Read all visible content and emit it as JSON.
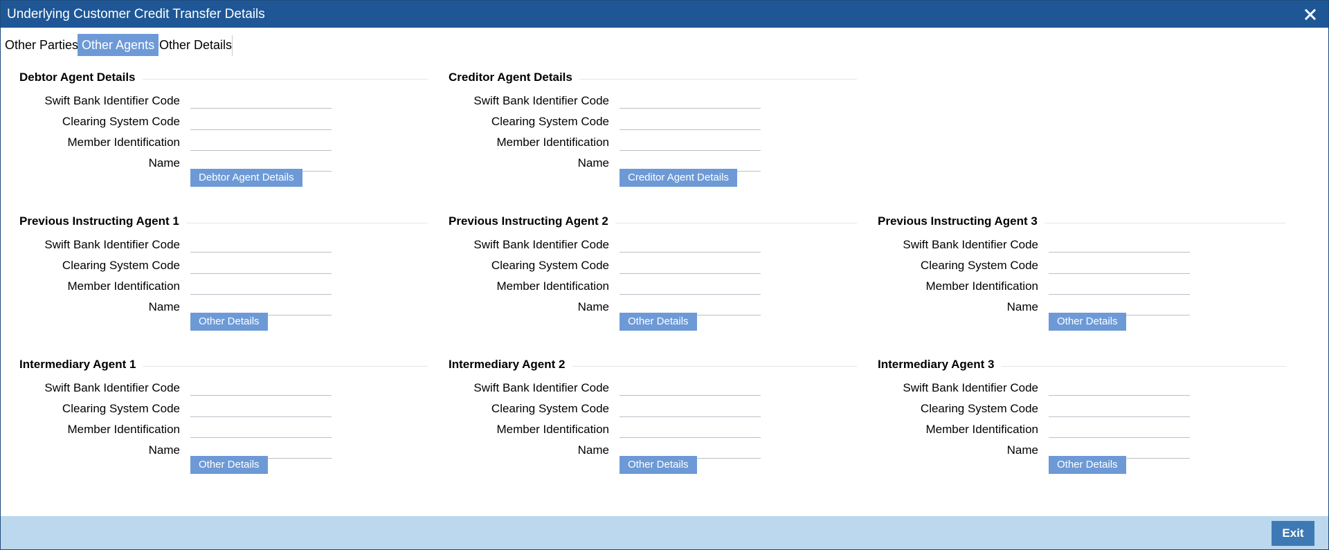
{
  "window": {
    "title": "Underlying Customer Credit Transfer Details",
    "close_icon": "close-icon"
  },
  "tabs": [
    {
      "label": "Other Parties",
      "active": false
    },
    {
      "label": "Other Agents",
      "active": true
    },
    {
      "label": "Other Details",
      "active": false
    }
  ],
  "sections": [
    {
      "heading": "Debtor Agent Details",
      "labels": [
        "Swift Bank Identifier Code",
        "Clearing System Code",
        "Member Identification",
        "Name"
      ],
      "values": [
        "",
        "",
        "",
        ""
      ],
      "button": "Debtor Agent Details"
    },
    {
      "heading": "Creditor Agent Details",
      "labels": [
        "Swift Bank Identifier Code",
        "Clearing System Code",
        "Member Identification",
        "Name"
      ],
      "values": [
        "",
        "",
        "",
        ""
      ],
      "button": "Creditor Agent Details"
    },
    {
      "heading": "Previous Instructing Agent 1",
      "labels": [
        "Swift Bank Identifier Code",
        "Clearing System Code",
        "Member Identification",
        "Name"
      ],
      "values": [
        "",
        "",
        "",
        ""
      ],
      "button": "Other Details"
    },
    {
      "heading": "Previous Instructing Agent 2",
      "labels": [
        "Swift Bank Identifier Code",
        "Clearing System Code",
        "Member Identification",
        "Name"
      ],
      "values": [
        "",
        "",
        "",
        ""
      ],
      "button": "Other Details"
    },
    {
      "heading": "Previous Instructing Agent 3",
      "labels": [
        "Swift Bank Identifier Code",
        "Clearing System Code",
        "Member Identification",
        "Name"
      ],
      "values": [
        "",
        "",
        "",
        ""
      ],
      "button": "Other Details"
    },
    {
      "heading": "Intermediary Agent 1",
      "labels": [
        "Swift Bank Identifier Code",
        "Clearing System Code",
        "Member Identification",
        "Name"
      ],
      "values": [
        "",
        "",
        "",
        ""
      ],
      "button": "Other Details"
    },
    {
      "heading": "Intermediary Agent 2",
      "labels": [
        "Swift Bank Identifier Code",
        "Clearing System Code",
        "Member Identification",
        "Name"
      ],
      "values": [
        "",
        "",
        "",
        ""
      ],
      "button": "Other Details"
    },
    {
      "heading": "Intermediary Agent 3",
      "labels": [
        "Swift Bank Identifier Code",
        "Clearing System Code",
        "Member Identification",
        "Name"
      ],
      "values": [
        "",
        "",
        "",
        ""
      ],
      "button": "Other Details"
    }
  ],
  "footer": {
    "exit_label": "Exit"
  },
  "colors": {
    "titlebar": "#1f5796",
    "active_tab": "#6d9ad6",
    "button": "#6d9ad6",
    "footer": "#bcd8ee",
    "exit_button": "#3d79b4"
  }
}
